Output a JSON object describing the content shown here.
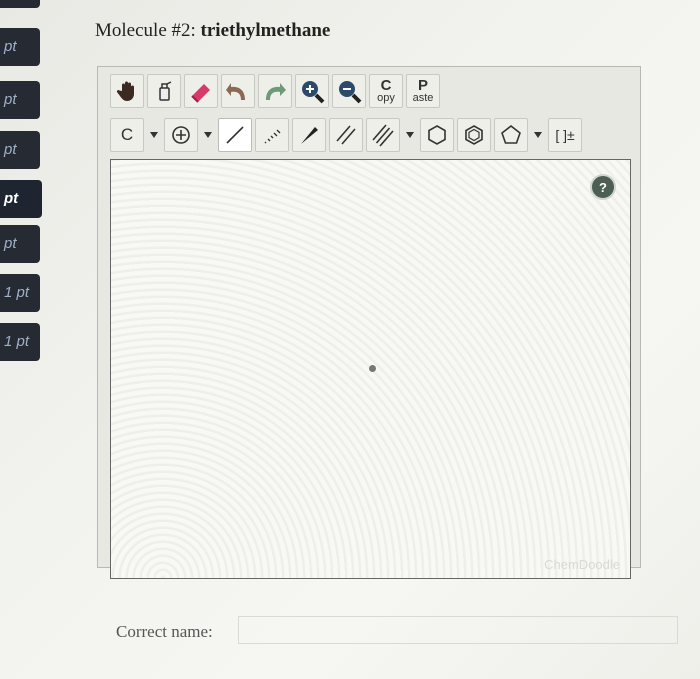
{
  "sidebar": {
    "tabs": [
      "pt",
      "pt",
      "pt",
      "pt",
      "pt",
      "1 pt",
      "1 pt"
    ],
    "active_index": 3
  },
  "question": {
    "prefix": "Molecule #2:",
    "name": "triethylmethane"
  },
  "toolbar": {
    "copy_top": "C",
    "copy_bottom": "opy",
    "paste_top": "P",
    "paste_bottom": "aste",
    "element": "C",
    "charge_label": "[ ]±"
  },
  "canvas": {
    "help_label": "?",
    "watermark": "ChemDoodle"
  },
  "answer": {
    "label": "Correct name:",
    "value": ""
  },
  "colors": {
    "sidebar_bg": "#262b33",
    "help_bg": "#4d5e52",
    "undo_arrow": "#8a6a55",
    "redo_arrow": "#6f9a7a",
    "eraser": "#d63a6a",
    "zoom": "#2c4a6a"
  }
}
